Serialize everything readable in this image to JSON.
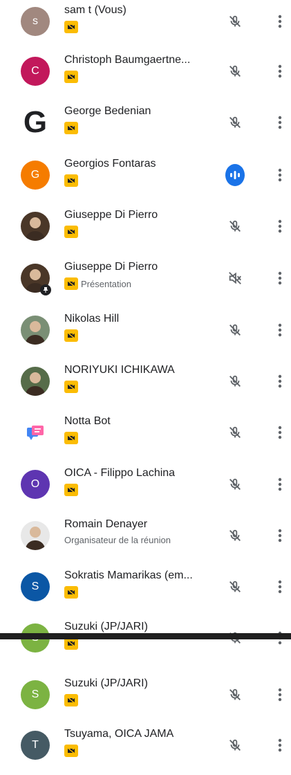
{
  "participants_top": [
    {
      "name": "sam t (Vous)",
      "initial": "s",
      "avatar_color": "#a1887f",
      "sub": "",
      "mic": "muted"
    },
    {
      "name": "Christoph Baumgaertne...",
      "initial": "C",
      "avatar_color": "#c2185b",
      "sub": "",
      "mic": "muted"
    },
    {
      "name": "George Bedenian",
      "initial": "G",
      "avatar_color": "transparent",
      "sub": "",
      "mic": "muted"
    },
    {
      "name": "Georgios Fontaras",
      "initial": "G",
      "avatar_color": "#f57c00",
      "sub": "",
      "mic": "speaking"
    },
    {
      "name": "Giuseppe Di Pierro",
      "initial": "",
      "avatar_color": "#4a3728",
      "sub": "",
      "mic": "muted"
    },
    {
      "name": "Giuseppe Di Pierro",
      "initial": "",
      "avatar_color": "#4a3728",
      "sub": "Présentation",
      "mic": "presenting"
    },
    {
      "name": "Nikolas Hill",
      "initial": "",
      "avatar_color": "#7a8f75",
      "sub": "",
      "mic": "muted"
    },
    {
      "name": "NORIYUKI ICHIKAWA",
      "initial": "",
      "avatar_color": "#566c49",
      "sub": "",
      "mic": "muted"
    },
    {
      "name": "Notta Bot",
      "initial": "",
      "avatar_color": "transparent",
      "sub": "",
      "mic": "muted"
    },
    {
      "name": "OICA - Filippo Lachina",
      "initial": "O",
      "avatar_color": "#5e35b1",
      "sub": "",
      "mic": "muted"
    },
    {
      "name": "Romain Denayer",
      "initial": "",
      "avatar_color": "#e8e8e8",
      "sub": "Organisateur de la réunion",
      "mic": "muted"
    },
    {
      "name": "Sokratis Mamarikas (em...",
      "initial": "S",
      "avatar_color": "#0b57a5",
      "sub": "",
      "mic": "muted"
    },
    {
      "name": "Suzuki (JP/JARI)",
      "initial": "S",
      "avatar_color": "#7cb342",
      "sub": "",
      "mic": "muted"
    }
  ],
  "participants_bottom": [
    {
      "name": "Suzuki (JP/JARI)",
      "initial": "S",
      "avatar_color": "#7cb342",
      "sub": "",
      "mic": "muted"
    },
    {
      "name": "Tsuyama, OICA JAMA",
      "initial": "T",
      "avatar_color": "#455a64",
      "sub": "",
      "mic": "muted"
    }
  ],
  "icons": {
    "muted": "mic-off-icon",
    "speaking": "audio-level-icon",
    "presenting": "volume-off-icon",
    "more": "more-vert-icon",
    "badge": "camera-off-badge-icon",
    "pin": "pin-icon"
  },
  "colors": {
    "badge": "#fbbc04",
    "speaking": "#1a73e8",
    "divider": "#1f1f1f"
  }
}
